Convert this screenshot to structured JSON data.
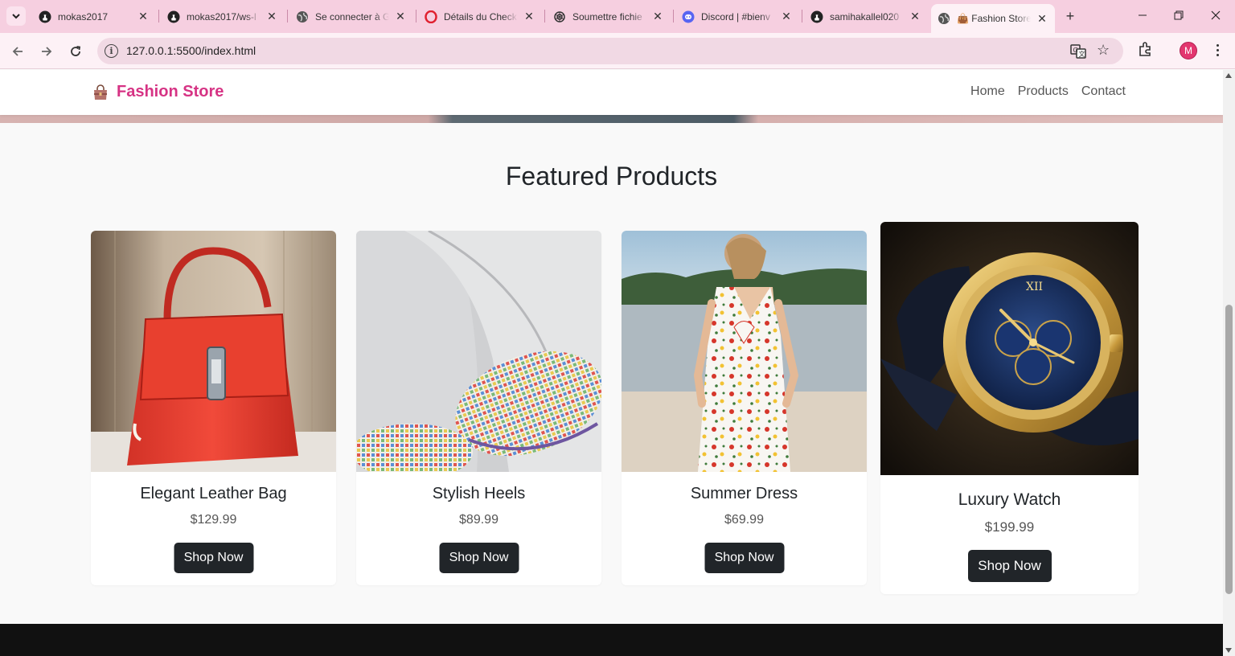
{
  "browser": {
    "tabs": [
      {
        "title": "mokas2017",
        "icon": "github-icon"
      },
      {
        "title": "mokas2017/ws-l",
        "icon": "github-icon"
      },
      {
        "title": "Se connecter à G",
        "icon": "globe-icon"
      },
      {
        "title": "Détails du Check",
        "icon": "opera-icon"
      },
      {
        "title": "Soumettre fichie",
        "icon": "openai-icon"
      },
      {
        "title": "Discord | #bienv",
        "icon": "discord-icon"
      },
      {
        "title": "samihakallel020",
        "icon": "github-icon"
      },
      {
        "title": "👜 Fashion Store",
        "icon": "globe-icon",
        "active": true
      }
    ],
    "url": "127.0.0.1:5500/index.html",
    "profile_initial": "M"
  },
  "navbar": {
    "brand": "Fashion Store",
    "brand_icon": "handbag-icon",
    "links": [
      "Home",
      "Products",
      "Contact"
    ]
  },
  "main": {
    "section_title": "Featured Products",
    "products": [
      {
        "name": "Elegant Leather Bag",
        "price": "$129.99",
        "button": "Shop Now",
        "image": "red-leather-handbag"
      },
      {
        "name": "Stylish Heels",
        "price": "$89.99",
        "button": "Shop Now",
        "image": "checkered-heels"
      },
      {
        "name": "Summer Dress",
        "price": "$69.99",
        "button": "Shop Now",
        "image": "floral-summer-dress"
      },
      {
        "name": "Luxury Watch",
        "price": "$199.99",
        "button": "Shop Now",
        "image": "gold-chronograph-watch"
      }
    ]
  },
  "colors": {
    "brand": "#d63384",
    "button": "#212529",
    "tabbar": "#f6cfe0",
    "footer": "#111111"
  }
}
